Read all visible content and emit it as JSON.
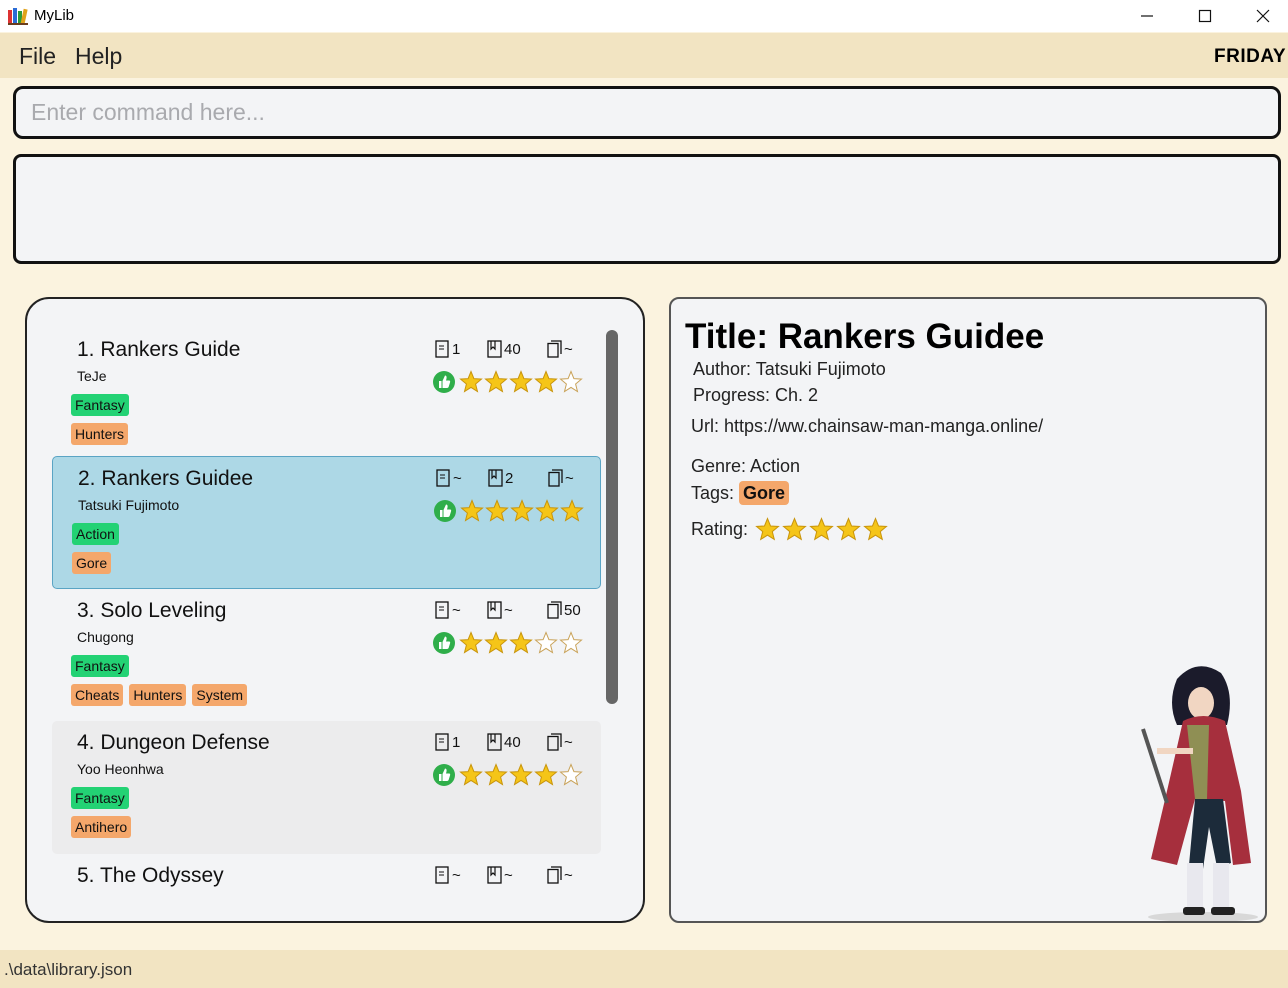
{
  "window": {
    "title": "MyLib"
  },
  "menu": {
    "file": "File",
    "help": "Help",
    "day": "FRIDAY"
  },
  "command": {
    "placeholder": "Enter command here..."
  },
  "result": {
    "text": ""
  },
  "books": [
    {
      "index_title": "1. Rankers Guide",
      "author": "TeJe",
      "genre": "Fantasy",
      "tags": [
        "Hunters"
      ],
      "chapter": "1",
      "page": "40",
      "volume": "~",
      "rating": 4,
      "state": "normal"
    },
    {
      "index_title": "2. Rankers Guidee",
      "author": "Tatsuki Fujimoto",
      "genre": "Action",
      "tags": [
        "Gore"
      ],
      "chapter": "~",
      "page": "2",
      "volume": "~",
      "rating": 5,
      "state": "selected"
    },
    {
      "index_title": "3. Solo Leveling",
      "author": "Chugong",
      "genre": "Fantasy",
      "tags": [
        "Cheats",
        "Hunters",
        "System"
      ],
      "chapter": "~",
      "page": "~",
      "volume": "50",
      "rating": 3,
      "state": "normal"
    },
    {
      "index_title": "4. Dungeon Defense",
      "author": "Yoo Heonhwa",
      "genre": "Fantasy",
      "tags": [
        "Antihero"
      ],
      "chapter": "1",
      "page": "40",
      "volume": "~",
      "rating": 4,
      "state": "hovered"
    },
    {
      "index_title": "5. The Odyssey",
      "author": "",
      "genre": "",
      "tags": [],
      "chapter": "~",
      "page": "~",
      "volume": "~",
      "rating": 0,
      "state": "partial"
    }
  ],
  "detail": {
    "title": "Title: Rankers Guidee",
    "author": "Author: Tatsuki Fujimoto",
    "progress": "Progress: Ch. 2",
    "url": "Url: https://ww.chainsaw-man-manga.online/",
    "genre": "Genre: Action",
    "tags_label": "Tags:",
    "tags": [
      "Gore"
    ],
    "rating_label": "Rating:",
    "rating": 5
  },
  "status": {
    "path": ".\\data\\library.json"
  },
  "colors": {
    "genre_tag": "#23d274",
    "tag": "#f4a76b",
    "selected_card": "#add8e6",
    "star": "#f5c518",
    "thumb": "#2fae4a"
  }
}
